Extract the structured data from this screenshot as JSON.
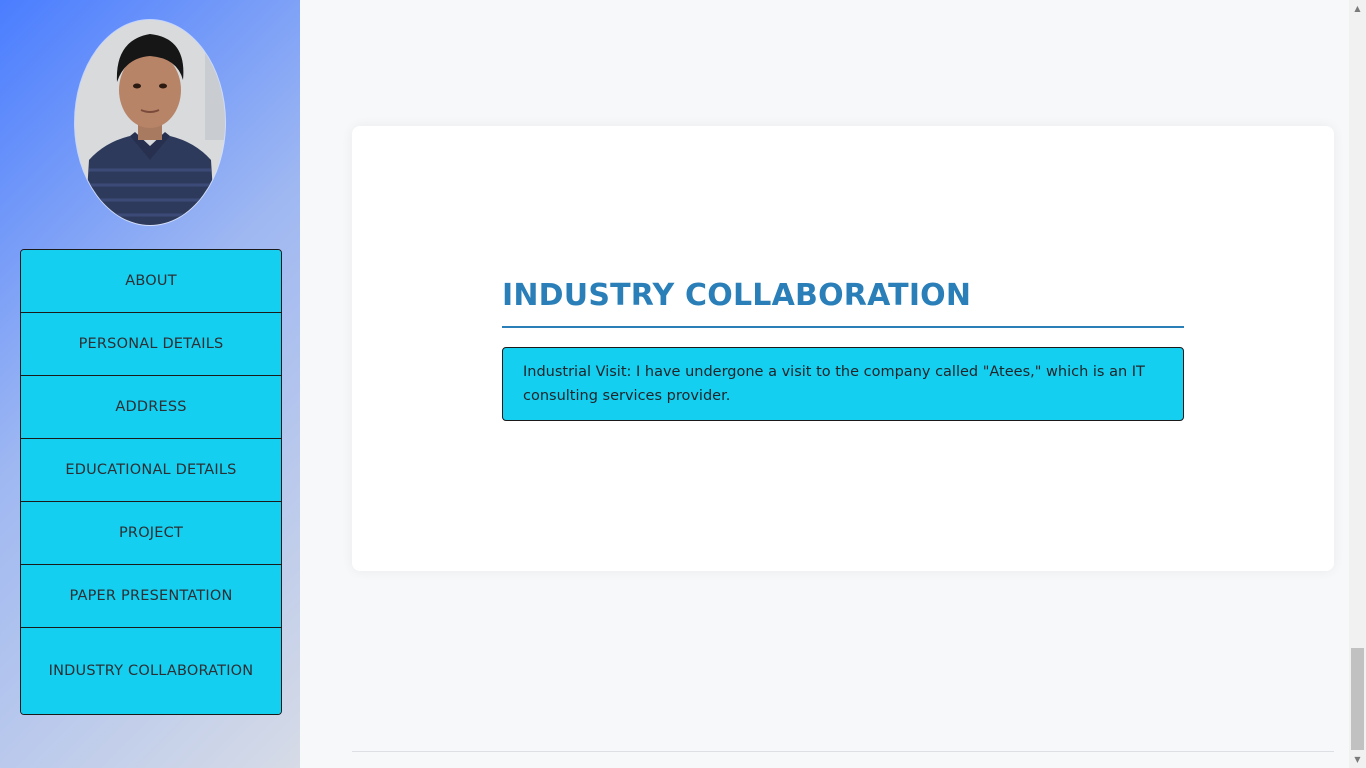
{
  "sidebar": {
    "items": [
      {
        "label": "ABOUT"
      },
      {
        "label": "PERSONAL DETAILS"
      },
      {
        "label": "ADDRESS"
      },
      {
        "label": "EDUCATIONAL DETAILS"
      },
      {
        "label": "PROJECT"
      },
      {
        "label": "PAPER PRESENTATION"
      },
      {
        "label": "INDUSTRY COLLABORATION"
      }
    ]
  },
  "main": {
    "title": "INDUSTRY COLLABORATION",
    "content": "Industrial Visit: I have undergone a visit to the company called \"Atees,\" which is an IT consulting services provider."
  },
  "colors": {
    "nav_bg": "#15cff0",
    "title": "#2a7fb8",
    "sidebar_gradient_start": "#4a7dff",
    "sidebar_gradient_end": "#d6dbe6"
  },
  "icons": {
    "scroll_up": "▲",
    "scroll_down": "▼"
  }
}
